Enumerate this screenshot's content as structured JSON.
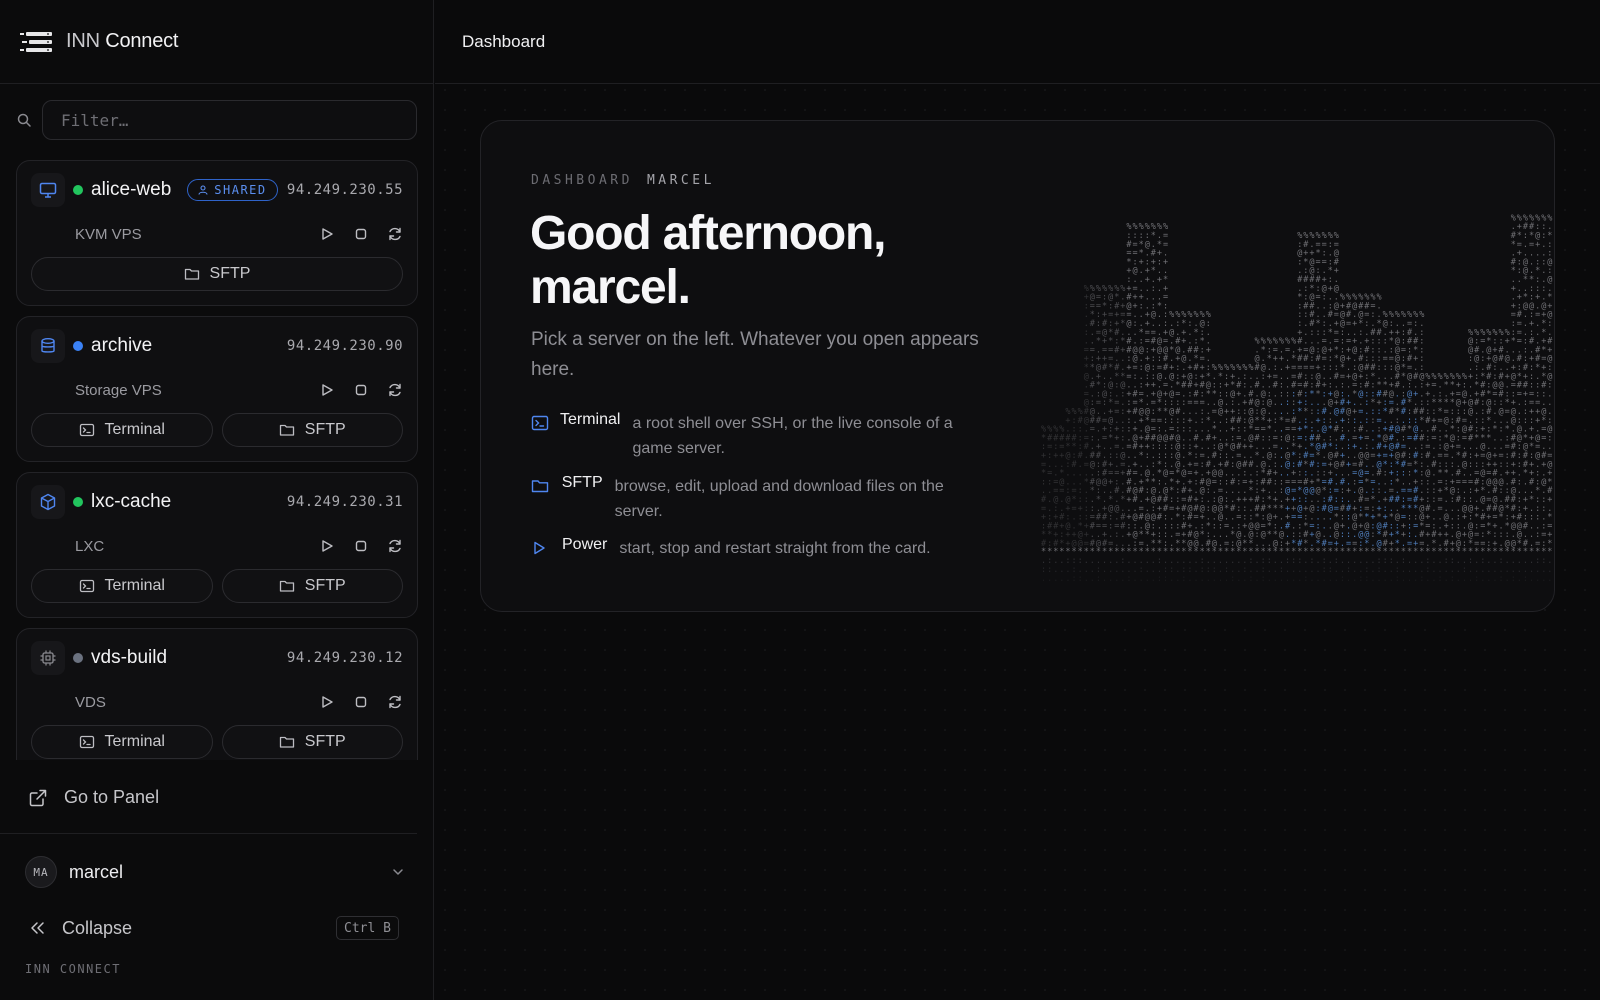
{
  "brand": {
    "name_a": "INN",
    "name_b": " Connect"
  },
  "filter": {
    "placeholder": "Filter…"
  },
  "servers": [
    {
      "name": "alice-web",
      "status": "online",
      "status_color": "#22c55e",
      "type": "KVM VPS",
      "ip": "94.249.230.55",
      "icon": "monitor-icon",
      "badge": "SHARED",
      "buttons": [
        "SFTP"
      ]
    },
    {
      "name": "archive",
      "status": "online",
      "status_color": "#3b82f6",
      "type": "Storage VPS",
      "ip": "94.249.230.90",
      "icon": "database-icon",
      "buttons": [
        "Terminal",
        "SFTP"
      ]
    },
    {
      "name": "lxc-cache",
      "status": "online",
      "status_color": "#22c55e",
      "type": "LXC",
      "ip": "94.249.230.31",
      "icon": "box-icon",
      "buttons": [
        "Terminal",
        "SFTP"
      ]
    },
    {
      "name": "vds-build",
      "status": "offline",
      "status_color": "#6b7280",
      "type": "VDS",
      "ip": "94.249.230.12",
      "icon": "cpu-icon",
      "buttons": [
        "Terminal",
        "SFTP"
      ]
    }
  ],
  "sidebar_bottom": {
    "go_to_panel": "Go to Panel",
    "user": {
      "initials": "MA",
      "name": "marcel"
    },
    "collapse": "Collapse",
    "shortcut": "Ctrl B",
    "footer": "INN CONNECT"
  },
  "topbar": {
    "title": "Dashboard"
  },
  "hero": {
    "eyebrow_a": "DASHBOARD",
    "eyebrow_b": "MARCEL",
    "greeting": "Good afternoon, marcel.",
    "subtitle": "Pick a server on the left. Whatever you open appears here.",
    "features": [
      {
        "title": "Terminal",
        "desc": "a root shell over SSH, or the live console of a game server.",
        "icon": "terminal-icon"
      },
      {
        "title": "SFTP",
        "desc": "browse, edit, upload and download files on the server.",
        "icon": "folder-icon"
      },
      {
        "title": "Power",
        "desc": "start, stop and restart straight from the card.",
        "icon": "play-icon"
      }
    ]
  },
  "colors": {
    "accent": "#3b82f6",
    "online": "#22c55e",
    "offline": "#6b7280"
  }
}
